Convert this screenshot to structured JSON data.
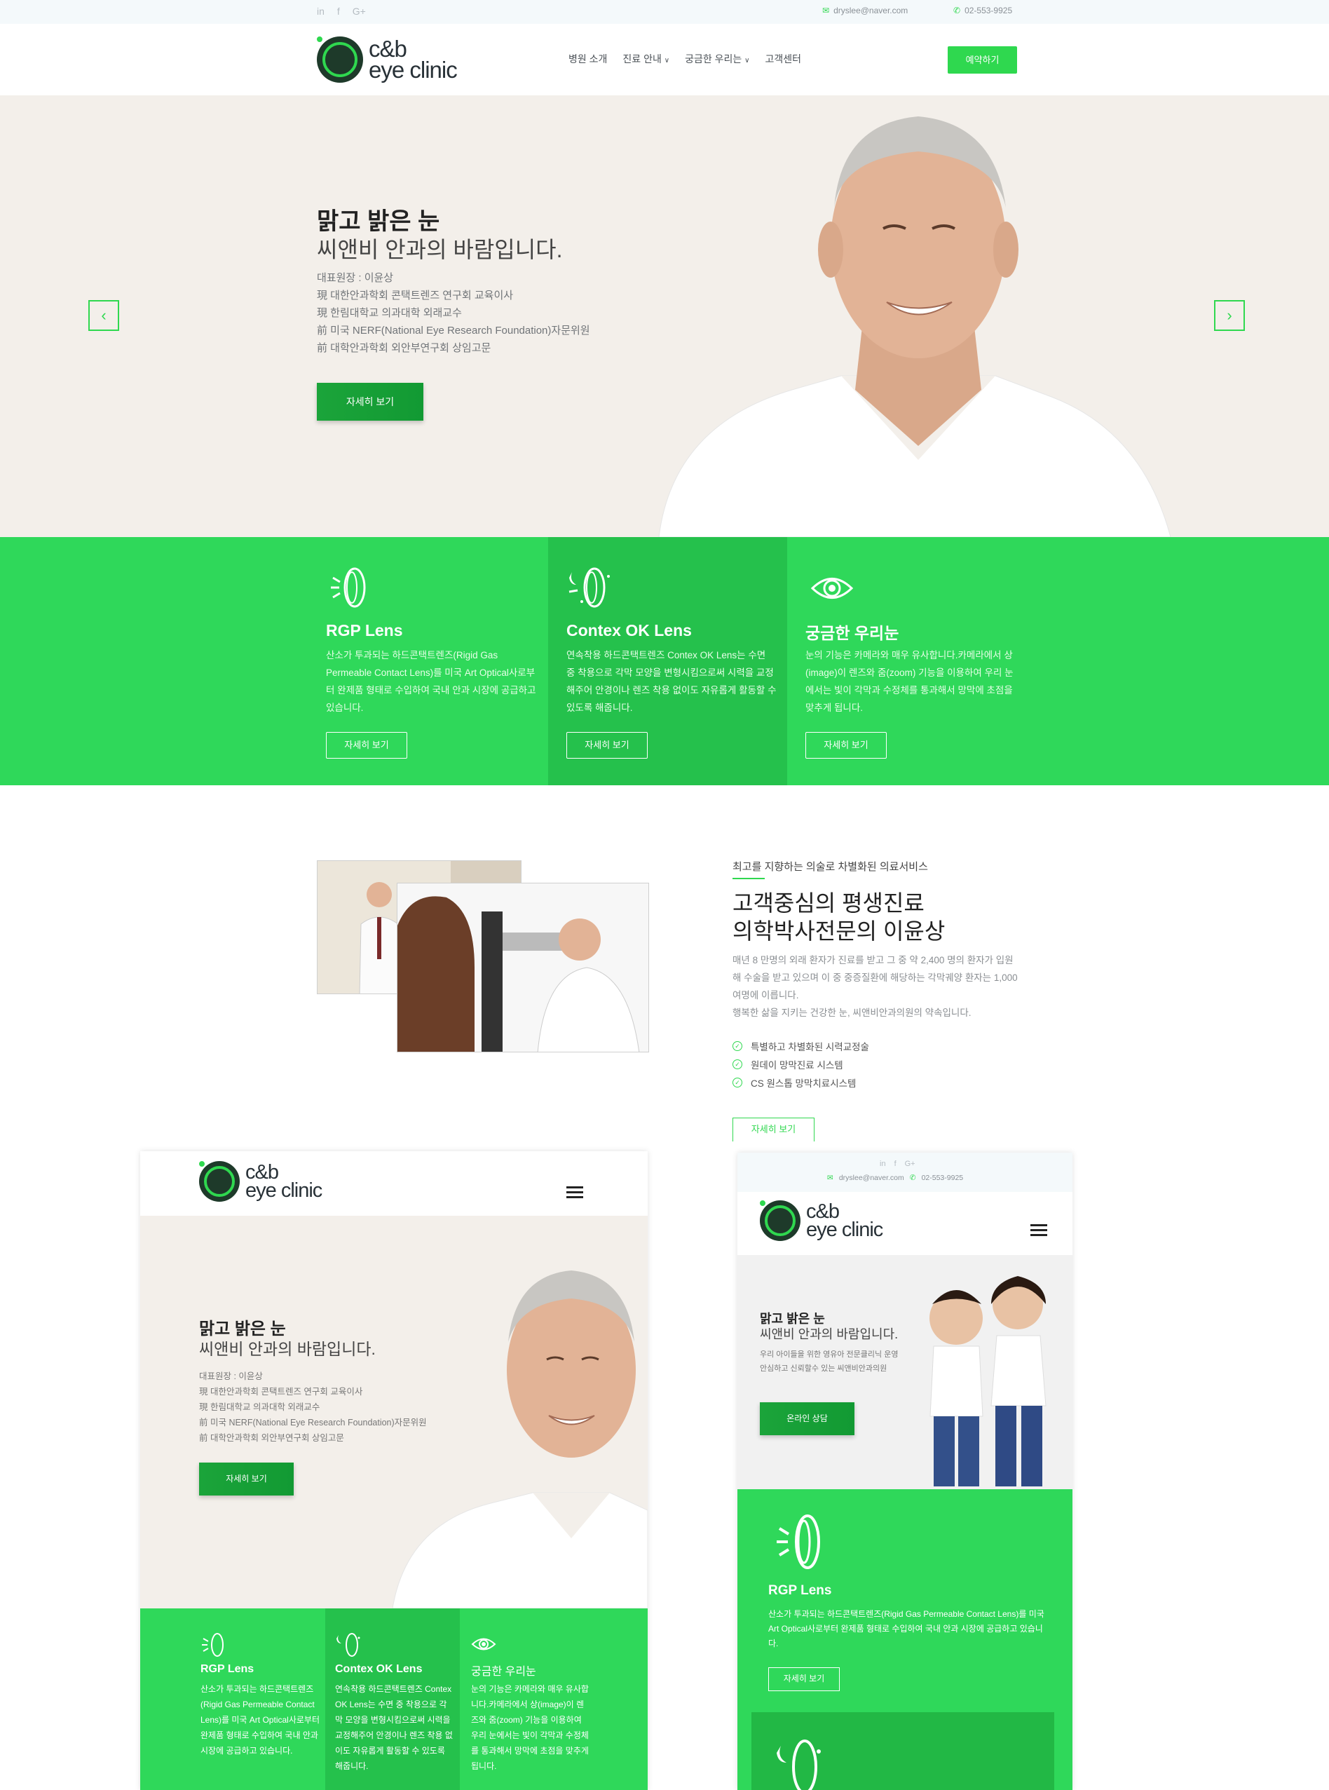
{
  "topbar": {
    "social": [
      "in",
      "f",
      "G+"
    ],
    "email": "dryslee@naver.com",
    "phone": "02-553-9925"
  },
  "brand": {
    "line1": "c&b",
    "line2": "eye clinic"
  },
  "nav": {
    "items": [
      "병원 소개",
      "진료 안내",
      "궁금한 우리는",
      "고객센터"
    ],
    "cta": "예약하기"
  },
  "hero": {
    "title_bold": "맑고 밝은 눈",
    "title_light": "씨앤비 안과의 바람입니다.",
    "lines": [
      "대표원장 : 이윤상",
      "現 대한안과학회 콘택트렌즈 연구회 교육이사",
      "現 한림대학교 의과대학 외래교수",
      "前 미국 NERF(National Eye Research Foundation)자문위원",
      "前 대학안과학회 외안부연구회 상임고문"
    ],
    "button": "자세히 보기",
    "prev": "‹",
    "next": "›"
  },
  "features": [
    {
      "icon": "contact-lens-icon",
      "title": "RGP Lens",
      "text": "산소가 투과되는 하드콘택트렌즈(Rigid Gas Permeable Contact Lens)를 미국 Art Optical사로부터 완제품 형태로 수입하여 국내 안과 시장에 공급하고 있습니다.",
      "button": "자세히 보기"
    },
    {
      "icon": "night-lens-icon",
      "title": "Contex OK Lens",
      "text": "연속착용 하드콘택트렌즈 Contex OK Lens는 수면 중 착용으로 각막 모양을 변형시킴으로써 시력을 교정해주어 안경이나 렌즈 착용 없이도 자유롭게 활동할 수 있도록 해줍니다.",
      "button": "자세히 보기"
    },
    {
      "icon": "eye-icon",
      "title": "궁금한 우리눈",
      "text": "눈의 기능은 카메라와 매우 유사합니다.카메라에서 상(image)이 렌즈와 줌(zoom) 기능을 이용하여 우리 눈에서는 빛이 각막과 수정체를 통과해서 망막에 초점을 맞추게 됩니다.",
      "button": "자세히 보기"
    }
  ],
  "about": {
    "subtitle": "최고를 지향하는 의술로 차별화된 의료서비스",
    "title_line1": "고객중심의 평생진료",
    "title_line2": "의학박사전문의 이윤상",
    "desc": "매년 8 만명의 외래 환자가 진료를 받고 그 중 약 2,400 명의 환자가 입원해 수술을 받고 있으며 이 중 중증질환에 해당하는 각막궤양 환자는 1,000 여명에 이릅니다.",
    "desc2": "행복한 삶을 지키는 건강한 눈, 씨앤비안과의원의 약속입니다.",
    "checks": [
      "특별하고 차별화된 시력교정술",
      "원데이 망막진료 시스템",
      "CS 원스톱 망막치료시스템"
    ],
    "button": "자세히 보기"
  },
  "tablet_mock": {
    "hero_lines": [
      "대표원장 : 이윤상",
      "現 대한안과학회 콘택트렌즈 연구회 교육이사",
      "現 한림대학교 의과대학 외래교수",
      "前 미국 NERF(National Eye Research Foundation)자문위원",
      "前 대학안과학회 외안부연구회 상임고문"
    ],
    "features": [
      {
        "title": "RGP Lens",
        "text": "산소가 투과되는 하드콘택트렌즈(Rigid Gas Permeable Contact Lens)를 미국 Art Optical사로부터 완제품 형태로 수입하여 국내 안과 시장에 공급하고 있습니다."
      },
      {
        "title": "Contex OK Lens",
        "text": "연속착용 하드콘택트렌즈 Contex OK Lens는 수면 중 착용으로 각막 모양을 변형시킴으로써 시력을 교정해주어 안경이나 렌즈 착용 없이도 자유롭게 활동할 수 있도록 해줍니다."
      },
      {
        "title": "궁금한 우리눈",
        "text": "눈의 기능은 카메라와 매우 유사합니다.카메라에서 상(image)이 렌즈와 줌(zoom) 기능을 이용하여 우리 눈에서는 빛이 각막과 수정체를 통과해서 망막에 초점을 맞추게 됩니다."
      }
    ]
  },
  "mobile_mock": {
    "hero_lines": [
      "우리 아이들을 위한 영유아 전문클리닉 운영",
      "안심하고 신뢰할수 있는 씨앤비안과의원"
    ],
    "button": "온라인 상담",
    "feature_title": "RGP Lens",
    "feature_text": "산소가 투과되는 하드콘택트렌즈(Rigid Gas Permeable Contact Lens)를 미국 Art Optical사로부터 완제품 형태로 수입하여 국내 안과 시장에 공급하고 있습니다.",
    "feature_button": "자세히 보기"
  },
  "colors": {
    "accent": "#2fd84f",
    "feature_bg": "#2fd85a",
    "feature_mid": "#25c14c",
    "hero_bg": "#f3efea",
    "topbar_bg": "#f4f9fb"
  }
}
